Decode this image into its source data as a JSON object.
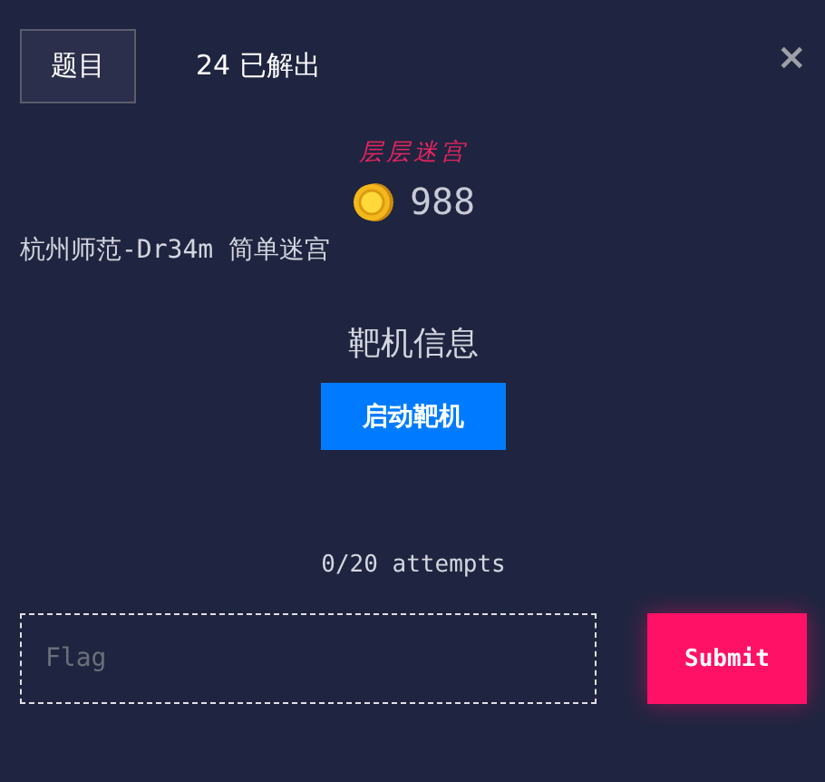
{
  "tabs": [
    {
      "label": "题目",
      "selected": true
    },
    {
      "label": "24 已解出",
      "selected": false
    }
  ],
  "close": {
    "label": "×"
  },
  "challenge": {
    "category": "层层迷宫",
    "value": "988",
    "name": "杭州师范-Dr34m 简单迷宫"
  },
  "target": {
    "heading": "靶机信息",
    "button": "启动靶机"
  },
  "attempts": "0/20 attempts",
  "flag_input": {
    "placeholder": "Flag"
  },
  "submit": "Submit"
}
